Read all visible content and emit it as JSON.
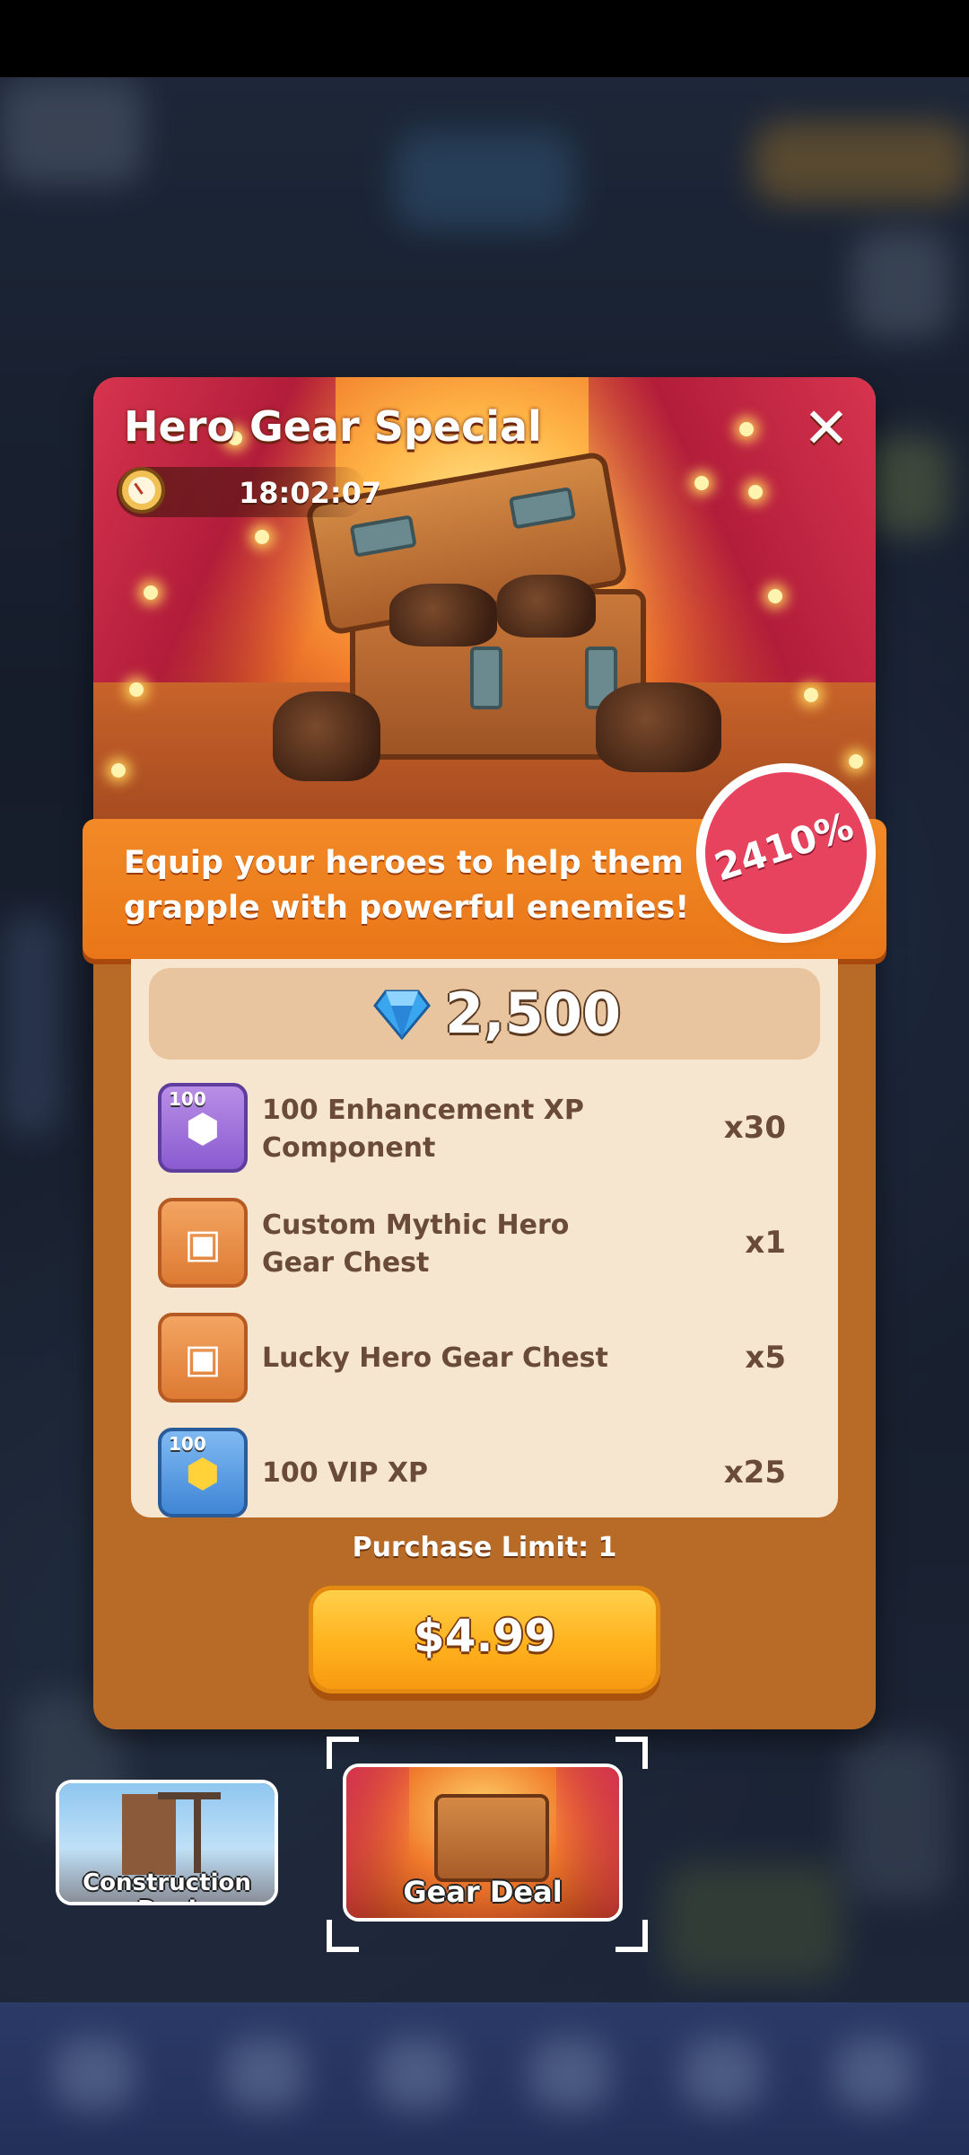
{
  "offer": {
    "title": "Hero Gear Special",
    "timer": "18:02:07",
    "close_symbol": "✕",
    "description": "Equip your heroes to help them grapple with powerful enemies!",
    "discount_badge": "2410%",
    "gem_price": "2,500",
    "items": [
      {
        "icon": "enhancement-xp-component-icon",
        "tag": "100",
        "name": "100 Enhancement XP Component",
        "qty": "x30"
      },
      {
        "icon": "mythic-gear-chest-icon",
        "tag": "",
        "name": "Custom Mythic Hero Gear Chest",
        "qty": "x1"
      },
      {
        "icon": "lucky-gear-chest-icon",
        "tag": "",
        "name": "Lucky Hero Gear Chest",
        "qty": "x5"
      },
      {
        "icon": "vip-xp-icon",
        "tag": "100",
        "name": "100 VIP XP",
        "qty": "x25"
      }
    ],
    "purchase_limit": "Purchase Limit: 1",
    "buy_price": "$4.99"
  },
  "deals": [
    {
      "label": "Construction Deal",
      "selected": false
    },
    {
      "label": "Gear Deal",
      "selected": true
    }
  ],
  "colors": {
    "modal_bg": "#b86a27",
    "banner": "#f28a26",
    "badge": "#e8435e",
    "panel": "#f6e5cf",
    "buy_button": "#ffb21d"
  }
}
